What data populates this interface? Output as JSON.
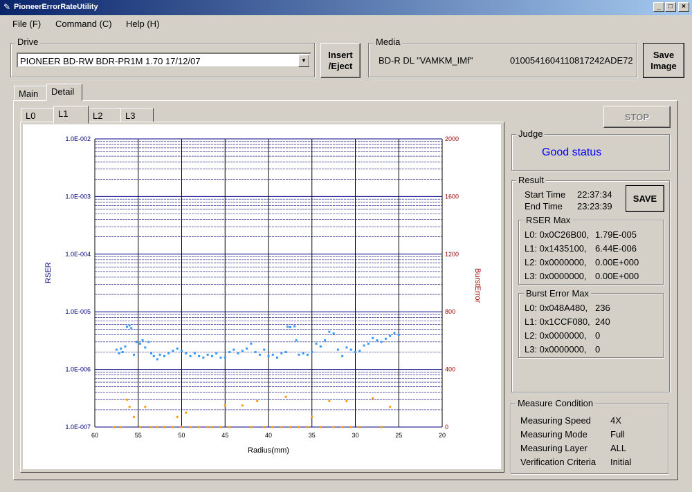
{
  "window": {
    "title": "PioneerErrorRateUtility"
  },
  "menu": [
    "File (F)",
    "Command (C)",
    "Help (H)"
  ],
  "drive": {
    "label": "Drive",
    "value": "PIONEER BD-RW BDR-PR1M  1.70 17/12/07"
  },
  "buttons": {
    "insert_eject": [
      "Insert",
      "/Eject"
    ],
    "save_image": [
      "Save",
      "Image"
    ],
    "stop": "STOP",
    "save": "SAVE"
  },
  "media": {
    "label": "Media",
    "type": "BD-R DL \"VAMKM_IMf\"",
    "id": "0100541604110817242ADE72"
  },
  "main_tabs": [
    "Main",
    "Detail"
  ],
  "layer_tabs": [
    "L0",
    "L1",
    "L2",
    "L3"
  ],
  "judge": {
    "label": "Judge",
    "status": "Good status"
  },
  "result": {
    "label": "Result",
    "start_label": "Start Time",
    "start_value": "22:37:34",
    "end_label": "End Time",
    "end_value": "23:23:39",
    "rser_label": "RSER Max",
    "rser": [
      {
        "addr": "L0: 0x0C26B00,",
        "val": "1.79E-005"
      },
      {
        "addr": "L1: 0x1435100,",
        "val": "6.44E-006"
      },
      {
        "addr": "L2: 0x0000000,",
        "val": "0.00E+000"
      },
      {
        "addr": "L3: 0x0000000,",
        "val": "0.00E+000"
      }
    ],
    "burst_label": "Burst Error Max",
    "burst": [
      {
        "addr": "L0: 0x048A480,",
        "val": "236"
      },
      {
        "addr": "L1: 0x1CCF080,",
        "val": "240"
      },
      {
        "addr": "L2: 0x0000000,",
        "val": "0"
      },
      {
        "addr": "L3: 0x0000000,",
        "val": "0"
      }
    ]
  },
  "measure": {
    "label": "Measure Condition",
    "rows": [
      {
        "k": "Measuring Speed",
        "v": "4X"
      },
      {
        "k": "Measuring Mode",
        "v": "Full"
      },
      {
        "k": "Measuring Layer",
        "v": "ALL"
      },
      {
        "k": "Verification Criteria",
        "v": "Initial"
      }
    ]
  },
  "colors": {
    "rser_series": "#3399ff",
    "burst_series": "#ff9900",
    "left_axis": "#000080",
    "right_axis": "#990000",
    "judge_text": "#0000ff"
  },
  "chart_data": {
    "type": "scatter",
    "xlabel": "Radius(mm)",
    "ylabel_left": "RSER",
    "ylabel_right": "BurstError",
    "xlim": [
      60,
      20
    ],
    "x_ticks": [
      "60",
      "55",
      "50",
      "45",
      "40",
      "35",
      "30",
      "25",
      "20"
    ],
    "y_left_scale": "log",
    "y_left_ticks": [
      "1.0E-002",
      "1.0E-003",
      "1.0E-004",
      "1.0E-005",
      "1.0E-006",
      "1.0E-007"
    ],
    "y_right_ticks": [
      "2000",
      "1600",
      "1200",
      "800",
      "400",
      "0"
    ],
    "ylim_right": [
      0,
      2000
    ],
    "series": [
      {
        "name": "RSER",
        "points": [
          [
            57.5,
            2.2e-06
          ],
          [
            57.2,
            1.9e-06
          ],
          [
            57.0,
            2.3e-06
          ],
          [
            56.8,
            2e-06
          ],
          [
            56.5,
            2.5e-06
          ],
          [
            56.3,
            5.5e-06
          ],
          [
            56.0,
            5.8e-06
          ],
          [
            55.8,
            5.2e-06
          ],
          [
            55.5,
            1.8e-06
          ],
          [
            55.2,
            3e-06
          ],
          [
            54.8,
            2.8e-06
          ],
          [
            54.5,
            3.2e-06
          ],
          [
            54.2,
            2.4e-06
          ],
          [
            53.8,
            3e-06
          ],
          [
            53.5,
            1.9e-06
          ],
          [
            53.2,
            1.7e-06
          ],
          [
            52.8,
            1.5e-06
          ],
          [
            52.5,
            1.8e-06
          ],
          [
            52.0,
            1.7e-06
          ],
          [
            51.5,
            1.9e-06
          ],
          [
            51.0,
            2.1e-06
          ],
          [
            50.5,
            2.3e-06
          ],
          [
            50.0,
            2.1e-06
          ],
          [
            49.5,
            1.9e-06
          ],
          [
            49.0,
            1.7e-06
          ],
          [
            48.5,
            1.9e-06
          ],
          [
            48.0,
            1.7e-06
          ],
          [
            47.5,
            1.6e-06
          ],
          [
            47.0,
            1.8e-06
          ],
          [
            46.5,
            1.7e-06
          ],
          [
            46.0,
            1.9e-06
          ],
          [
            45.5,
            1.6e-06
          ],
          [
            45.0,
            1.6e-06
          ],
          [
            44.5,
            2e-06
          ],
          [
            44.0,
            2.2e-06
          ],
          [
            43.5,
            1.9e-06
          ],
          [
            43.0,
            2.1e-06
          ],
          [
            42.5,
            2.3e-06
          ],
          [
            42.0,
            2.8e-06
          ],
          [
            41.5,
            2e-06
          ],
          [
            41.0,
            1.8e-06
          ],
          [
            40.5,
            2.2e-06
          ],
          [
            40.0,
            1.7e-06
          ],
          [
            39.5,
            1.8e-06
          ],
          [
            39.0,
            1.6e-06
          ],
          [
            38.5,
            1.9e-06
          ],
          [
            38.0,
            2e-06
          ],
          [
            37.8,
            5.5e-06
          ],
          [
            37.5,
            5.4e-06
          ],
          [
            37.0,
            5.6e-06
          ],
          [
            36.8,
            3.2e-06
          ],
          [
            36.5,
            1.8e-06
          ],
          [
            36.0,
            1.9e-06
          ],
          [
            35.5,
            1.8e-06
          ],
          [
            35.0,
            2e-06
          ],
          [
            34.5,
            2.8e-06
          ],
          [
            34.0,
            2.5e-06
          ],
          [
            33.5,
            3.2e-06
          ],
          [
            33.0,
            4.5e-06
          ],
          [
            32.5,
            4.2e-06
          ],
          [
            32.0,
            2.2e-06
          ],
          [
            31.5,
            1.7e-06
          ],
          [
            31.0,
            2.4e-06
          ],
          [
            30.5,
            2.2e-06
          ],
          [
            30.0,
            2e-06
          ],
          [
            29.5,
            2.1e-06
          ],
          [
            29.0,
            2.6e-06
          ],
          [
            28.5,
            2.8e-06
          ],
          [
            28.0,
            3.5e-06
          ],
          [
            27.5,
            3.2e-06
          ],
          [
            27.0,
            3e-06
          ],
          [
            26.5,
            3.4e-06
          ],
          [
            26.0,
            3.8e-06
          ],
          [
            25.5,
            4.3e-06
          ],
          [
            25.0,
            4e-06
          ]
        ]
      },
      {
        "name": "BurstError",
        "points": [
          [
            57.8,
            0
          ],
          [
            57.0,
            0
          ],
          [
            56.3,
            190
          ],
          [
            56.0,
            140
          ],
          [
            55.5,
            70
          ],
          [
            54.8,
            0
          ],
          [
            54.2,
            140
          ],
          [
            53.5,
            0
          ],
          [
            52.8,
            0
          ],
          [
            52.0,
            0
          ],
          [
            51.0,
            0
          ],
          [
            50.5,
            70
          ],
          [
            50.0,
            0
          ],
          [
            49.5,
            100
          ],
          [
            49.0,
            0
          ],
          [
            48.0,
            0
          ],
          [
            47.0,
            0
          ],
          [
            46.5,
            0
          ],
          [
            45.5,
            0
          ],
          [
            45.0,
            150
          ],
          [
            44.5,
            0
          ],
          [
            43.0,
            150
          ],
          [
            42.0,
            0
          ],
          [
            41.3,
            180
          ],
          [
            40.5,
            0
          ],
          [
            39.5,
            0
          ],
          [
            38.5,
            0
          ],
          [
            38.0,
            210
          ],
          [
            37.5,
            0
          ],
          [
            36.5,
            0
          ],
          [
            35.5,
            0
          ],
          [
            35.0,
            70
          ],
          [
            34.0,
            0
          ],
          [
            33.0,
            180
          ],
          [
            32.5,
            0
          ],
          [
            31.5,
            0
          ],
          [
            31.0,
            180
          ],
          [
            30.5,
            0
          ],
          [
            29.5,
            0
          ],
          [
            28.0,
            200
          ],
          [
            27.0,
            0
          ],
          [
            26.0,
            140
          ]
        ]
      }
    ]
  }
}
